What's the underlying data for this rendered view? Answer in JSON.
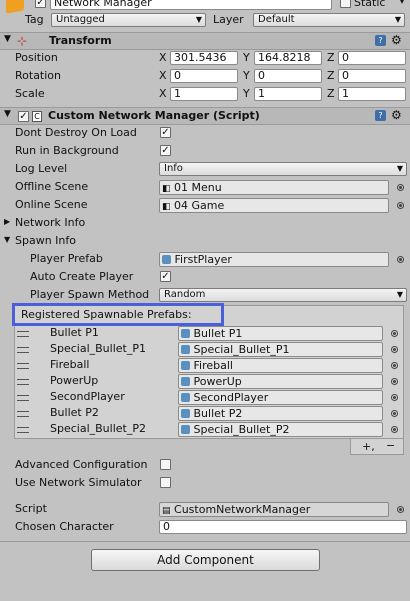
{
  "gameobject": {
    "name": "Network Manager",
    "static_label": "Static",
    "tag_label": "Tag",
    "tag_value": "Untagged",
    "layer_label": "Layer",
    "layer_value": "Default"
  },
  "transform": {
    "title": "Transform",
    "rows": [
      {
        "label": "Position",
        "x": "301.5436",
        "y": "164.8218",
        "z": "0"
      },
      {
        "label": "Rotation",
        "x": "0",
        "y": "0",
        "z": "0"
      },
      {
        "label": "Scale",
        "x": "1",
        "y": "1",
        "z": "1"
      }
    ],
    "axis": {
      "x": "X",
      "y": "Y",
      "z": "Z"
    }
  },
  "network_manager": {
    "title": "Custom Network Manager (Script)",
    "dont_destroy_label": "Dont Destroy On Load",
    "dont_destroy": true,
    "run_bg_label": "Run in Background",
    "run_bg": true,
    "log_level_label": "Log Level",
    "log_level": "Info",
    "offline_scene_label": "Offline Scene",
    "offline_scene": "01 Menu",
    "online_scene_label": "Online Scene",
    "online_scene": "04 Game",
    "network_info_label": "Network Info",
    "spawn_info_label": "Spawn Info",
    "player_prefab_label": "Player Prefab",
    "player_prefab": "FirstPlayer",
    "auto_create_label": "Auto Create Player",
    "auto_create": true,
    "spawn_method_label": "Player Spawn Method",
    "spawn_method": "Random",
    "registered_label": "Registered Spawnable Prefabs:",
    "prefabs": [
      {
        "name": "Bullet P1",
        "value": "Bullet P1"
      },
      {
        "name": "Special_Bullet_P1",
        "value": "Special_Bullet_P1"
      },
      {
        "name": "Fireball",
        "value": "Fireball"
      },
      {
        "name": "PowerUp",
        "value": "PowerUp"
      },
      {
        "name": "SecondPlayer",
        "value": "SecondPlayer"
      },
      {
        "name": "Bullet P2",
        "value": "Bullet P2"
      },
      {
        "name": "Special_Bullet_P2",
        "value": "Special_Bullet_P2"
      }
    ],
    "plus_label": "+,",
    "minus_label": "−",
    "advanced_label": "Advanced Configuration",
    "advanced": false,
    "simulator_label": "Use Network Simulator",
    "simulator": false,
    "script_label": "Script",
    "script_value": "CustomNetworkManager",
    "chosen_label": "Chosen Character",
    "chosen_value": "0"
  },
  "add_component_label": "Add Component",
  "colors": {
    "highlight": "#4a5fd8",
    "panel": "#c2c2c2"
  }
}
